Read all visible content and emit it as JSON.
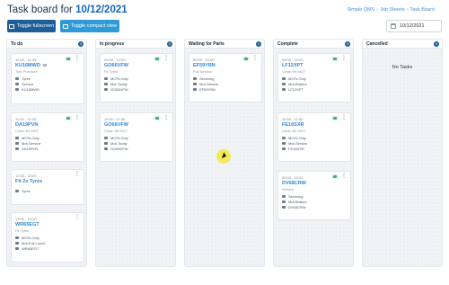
{
  "header": {
    "title_prefix": "Task board for ",
    "title_date": "10/12/2021",
    "links": [
      "Simple QMS",
      "Job Sheets",
      "Task Board"
    ]
  },
  "toolbar": {
    "toggle_fullscreen": "Toggle fullscreen",
    "toggle_compact": "Toggle compact view",
    "date_value": "10/12/2021"
  },
  "colors": {
    "primary": "#1d5f98",
    "secondary": "#2f9ad6",
    "code": "#2f86d1",
    "status_green": "#3bb07a"
  },
  "columns": [
    {
      "title": "To do",
      "count": "4",
      "cards": [
        {
          "time": "10:00 - 11:45",
          "code": "KU16MWD",
          "sub": "Tyre Puncture",
          "lines": [
            "Tyres",
            "Service",
            "KU16MWD"
          ],
          "link": true
        },
        {
          "time": "11:00 - 11:45",
          "code": "DA19PVN",
          "sub": "Clean Mr MOT",
          "lines": [
            "MOTs Only",
            "Mot-Service",
            "DA19PVN"
          ]
        },
        {
          "time": "12:00 - 13:00",
          "code": "Fit 2x Tyres",
          "sub": "",
          "lines": [
            "Tyres"
          ]
        },
        {
          "time": "13:00 - 14:30",
          "code": "WR65EGT",
          "sub": "Fit Tyres",
          "lines": [
            "MOTs Only",
            "Mot-Full Lunch",
            "WR65EGT"
          ]
        }
      ]
    },
    {
      "title": "In progress",
      "count": "2",
      "cards": [
        {
          "time": "09:00 - 10:00",
          "code": "GO66VFW",
          "sub": "Fit Tyres",
          "lines": [
            "MOTs Only",
            "Mot-Today",
            "GO66VFW"
          ]
        },
        {
          "time": "10:00 - 11:00",
          "code": "GO66VFW",
          "sub": "Clean Mr MOT",
          "lines": [
            "MOTs Only",
            "Mot-Today",
            "GO66VFW"
          ]
        }
      ]
    },
    {
      "title": "Waiting for Parts",
      "count": "1",
      "cards": [
        {
          "time": "09:00 - 10:00",
          "code": "EF59YBN",
          "sub": "Full Service",
          "lines": [
            "Servicing",
            "Mot-Service",
            "EF59YBN"
          ]
        }
      ]
    },
    {
      "title": "Complete",
      "count": "3",
      "cards": [
        {
          "time": "09:00 - 10:00",
          "code": "LF12XPT",
          "sub": "Clean Mr MOT",
          "lines": [
            "MOTs Only",
            "Mot-Brakes",
            "LF12XPT"
          ]
        },
        {
          "time": "10:00 - 11:00",
          "code": "FE16SXR",
          "sub": "Clean Mr MOT",
          "lines": [
            "MOTs Only",
            "Mot-Service",
            "FE16SXR"
          ]
        },
        {
          "time": "09:00 - 10:00",
          "code": "DV68CRW",
          "sub": "Service",
          "lines": [
            "Servicing",
            "Mot-Brakes",
            "DV68CRW"
          ]
        }
      ]
    },
    {
      "title": "Cancelled",
      "count": "0",
      "empty_text": "No Tasks",
      "cards": []
    }
  ]
}
